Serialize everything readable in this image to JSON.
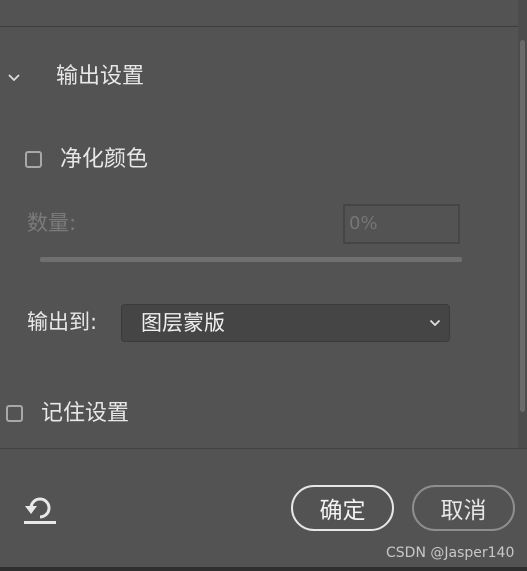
{
  "section": {
    "title": "输出设置"
  },
  "decontaminate": {
    "label": "净化颜色",
    "checked": false
  },
  "amount": {
    "label": "数量:",
    "value": "0%",
    "enabled": false
  },
  "output_to": {
    "label": "输出到:",
    "selected": "图层蒙版"
  },
  "remember": {
    "label": "记住设置",
    "checked": false
  },
  "buttons": {
    "ok": "确定",
    "cancel": "取消"
  },
  "icons": {
    "collapse": "chevron-down-icon",
    "reset": "reset-icon",
    "dropdown": "chevron-down-icon"
  },
  "watermark": "CSDN @Jasper140"
}
